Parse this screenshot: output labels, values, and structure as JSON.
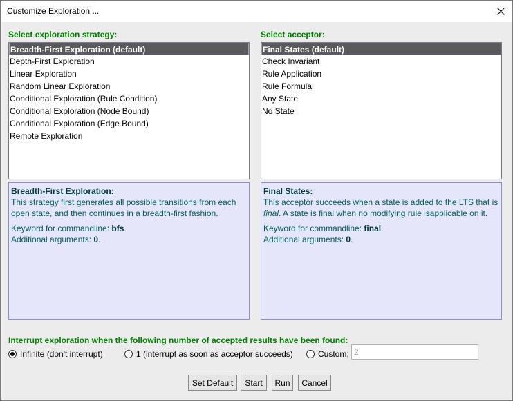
{
  "window": {
    "title": "Customize Exploration ..."
  },
  "strategy": {
    "label": "Select exploration strategy:",
    "items": [
      "Breadth-First Exploration (default)",
      "Depth-First Exploration",
      "Linear Exploration",
      "Random Linear Exploration",
      "Conditional Exploration (Rule Condition)",
      "Conditional Exploration (Node Bound)",
      "Conditional Exploration (Edge Bound)",
      "Remote Exploration"
    ],
    "selected_index": 0,
    "info": {
      "title": "Breadth-First Exploration:",
      "description": "This strategy first generates all possible transitions from each open state, and then continues in a breadth-first fashion.",
      "keyword_label": "Keyword for commandline: ",
      "keyword": "bfs",
      "args_label": "Additional arguments: ",
      "args": "0",
      "period": "."
    }
  },
  "acceptor": {
    "label": "Select acceptor:",
    "items": [
      "Final States (default)",
      "Check Invariant",
      "Rule Application",
      "Rule Formula",
      "Any State",
      "No State"
    ],
    "selected_index": 0,
    "info": {
      "title": "Final States:",
      "description_pre": "This acceptor succeeds when a state is added to the LTS that is ",
      "description_em": "final",
      "description_post": ". A state is final when no modifying rule isapplicable on it.",
      "keyword_label": "Keyword for commandline: ",
      "keyword": "final",
      "args_label": "Additional arguments: ",
      "args": "0",
      "period": "."
    }
  },
  "interrupt": {
    "label": "Interrupt exploration when the following number of accepted results have been found:",
    "options": {
      "infinite": "Infinite (don't interrupt)",
      "one": "1 (interrupt as soon as acceptor succeeds)",
      "custom": "Custom:"
    },
    "selected": "infinite",
    "custom_value": "2"
  },
  "buttons": {
    "set_default": "Set Default",
    "start": "Start",
    "run": "Run",
    "cancel": "Cancel"
  },
  "colors": {
    "section_label": "#008000",
    "info_background": "#e6e6fa",
    "selected_item": "#5a5a5a"
  }
}
